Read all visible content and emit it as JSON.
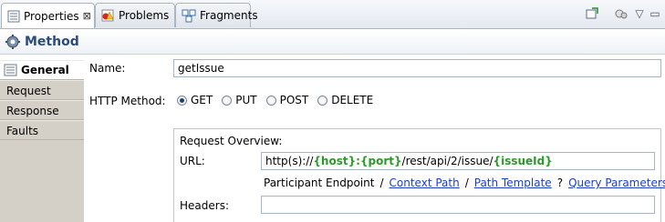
{
  "tabs": [
    {
      "label": "Properties",
      "icon": "properties-icon",
      "active": true,
      "close": "⊠"
    },
    {
      "label": "Problems",
      "icon": "problems-icon"
    },
    {
      "label": "Fragments",
      "icon": "fragments-icon"
    }
  ],
  "toolbar": {
    "pin_icon": "pin-icon",
    "menu_icon": "view-menu-icon",
    "minimize": "▽",
    "maximize": "▭"
  },
  "header": {
    "title": "Method",
    "icon": "method-gear-icon"
  },
  "nav": {
    "items": [
      {
        "label": "General",
        "active": true
      },
      {
        "label": "Request"
      },
      {
        "label": "Response"
      },
      {
        "label": "Faults"
      }
    ]
  },
  "form": {
    "name_label": "Name:",
    "name_value": "getIssue",
    "http_method_label": "HTTP Method:",
    "methods": [
      "GET",
      "PUT",
      "POST",
      "DELETE"
    ],
    "selected_method": "GET"
  },
  "overview": {
    "title": "Request Overview:",
    "url_label": "URL:",
    "url_parts": {
      "prefix": "http(s)://",
      "host": "{host}",
      "colon": ":",
      "port": "{port}",
      "path": "/rest/api/2/issue/",
      "issue": "{issueId}"
    },
    "participant_label": "Participant Endpoint",
    "slash": "/",
    "links": [
      "Context Path",
      "Path Template",
      "Query Parameters"
    ],
    "query_separator": "?",
    "headers_label": "Headers:"
  }
}
